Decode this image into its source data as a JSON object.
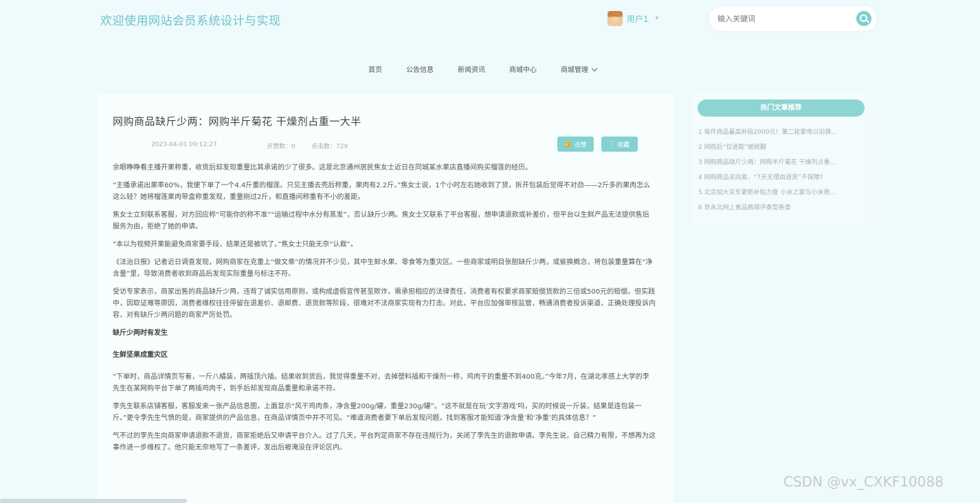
{
  "header": {
    "site_title": "欢迎使用网站会员系统设计与实现",
    "user_name": "用户1",
    "user_caret": "▾",
    "search_placeholder": "输入关键词"
  },
  "nav": {
    "items": [
      "首页",
      "公告信息",
      "新闻资讯",
      "商城中心",
      "商城管理"
    ]
  },
  "article": {
    "title": "网购商品缺斤少两：网购半斤菊花 干燥剂占重一大半",
    "date": "2023-04-01 09:12:27",
    "likes": "点赞数：0",
    "views": "点击数：729",
    "like_button": "点赞",
    "fav_button": "收藏",
    "paragraphs": [
      "余眼睁睁看主播开果称重，收货后却发现重量比其承诺的少了很多。这是北京通州居民焦女士近日在同城某水果店直播间购买榴莲的经历。",
      "“主播承诺出果率60%，我便下单了一个4.4斤重的榴莲。只见主播去壳后称重，果肉有2.2斤。”焦女士说，1个小时左右她收到了货，拆开包装后觉得不对劲——2斤多的果肉怎么这么轻？她将榴莲果肉带盒称重发现，重量刚过2斤，和直播间称重有不小的差距。",
      "焦女士立刻联系客服，对方回应称“可能你的称不准”“运输过程中水分有蒸发”，否认缺斤少两。焦女士又联系了平台客服，想申请退款或补差价，但平台以生鲜产品无法提供售后服务为由，拒绝了她的申请。",
      "“本以为视频开果能避免商家要手段，结果还是被坑了。”焦女士只能无奈“认栽”。",
      "《法治日报》记者近日调查发现，网购商家在克重上“做文章”的情况并不少见，其中生鲜水果、零食等为重灾区。一些商家或明目张胆缺斤少两，或偷换概念，将包装重量算在“净含量”里，导致消费者收到商品后发现实际重量与标注不符。",
      "受访专家表示，商家出售的商品缺斤少两，违背了诚实信用原则，或构成虚假宣传甚至欺诈，需承担相应的法律责任，消费者有权要求商家赔偿货款的三倍或500元的赔偿。但实践中，因取证难等原因，消费者维权往往停留在退差价、退邮费、退货款等阶段，很难对不法商家实现有力打击。对此，平台应加强审核监管，畅通消费者投诉渠道，正确处理投诉内容，对有缺斤少两问题的商家严厉处罚。"
    ],
    "heading1": "缺斤少两时有发生",
    "heading2": "生鲜坚果成重灾区",
    "paragraphs2": [
      "“下单时，商品详情页写着，一斤八橘装，两插顶六插。结果收到货后，我觉得重量不对，去掉塑料插和干燥剂一称，鸡肉干的重量不到400克。”今年7月，在湖北孝感上大学的李先生在某网购平台下单了两插鸡肉干，到手后却发现商品重量和承诺不符。",
      "李先生联系店铺客服，客服发来一张产品信息图，上面显示“风干鸡肉条，净含量200g/罐，重量230g/罐”。“这不就是在玩‘文字游戏’吗，买的时候说一斤装，结果是连包装一斤。”更令李先生气愤的是，商家提供的产品信息，在商品详情页中并不可见。“难道消费者要下单后发现问题，找到客服才能知道‘净含量’和‘净重’的具体信息？”",
      "气不过的李先生向商家申请退款不退货，商家拒绝后又申请平台介入。过了几天，平台判定商家不存在违规行为，关闭了李先生的退款申请。李先生说，自己精力有限，不想再为这事作进一步维权了。他只能无奈地写了一条差评，发出后被淹没在评论区内。"
    ]
  },
  "sidebar": {
    "header": "热门文章推荐",
    "items": [
      "1  每件商品最高补贴2000元！第二轮家电以旧换…",
      "2  网购后“仅退款”被掀翻",
      "3  网购商品缺斤少两：网购半斤菊花 干燥剂占重…",
      "4  网购商品买向易，“7天无理由退货”不保障?",
      "5  北京加大京东更新补贴力度 小米之家与小米商…",
      "6  世永北网上食品商城评奏型各类"
    ]
  },
  "watermark": "CSDN @vx_CXKF10088"
}
